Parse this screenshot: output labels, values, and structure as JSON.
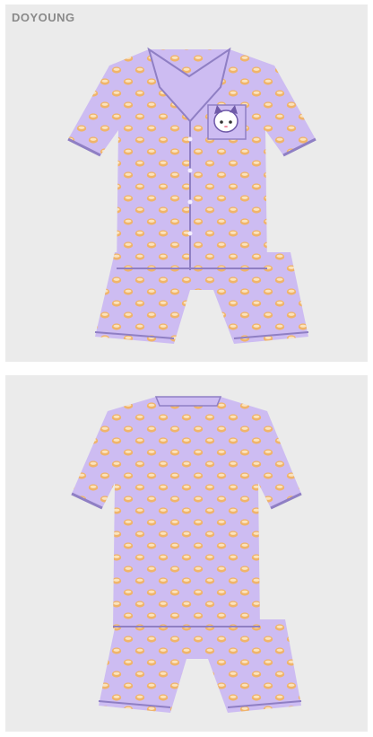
{
  "brand": {
    "text": "DOYOUNG",
    "color": "#8a8a8a"
  },
  "panels": [
    {
      "name": "front-view",
      "background": "#ebebeb"
    },
    {
      "name": "back-view",
      "background": "#ebebeb"
    }
  ],
  "product": {
    "fabric_color": "#cdbcf2",
    "piping_color": "#8f7fc4",
    "dot_color": "#f0b46a",
    "dot_highlight": "#fbe3bd",
    "patch_icon": "character-face-icon"
  }
}
